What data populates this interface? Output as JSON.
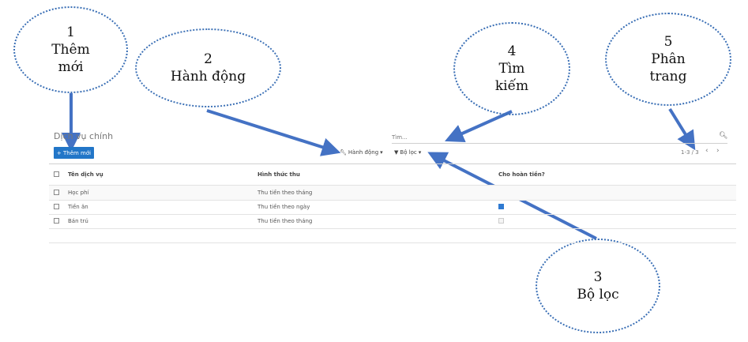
{
  "breadcrumb": {
    "title": "Dịch vụ chính"
  },
  "toolbar": {
    "add_label": "+ Thêm mới",
    "action_label": "Hành động",
    "filter_label": "Bộ lọc",
    "search_placeholder": "Tìm...",
    "pager_text": "1-3 / 3",
    "prev_label": "‹",
    "next_label": "›"
  },
  "table": {
    "columns": [
      "Tên dịch vụ",
      "Hình thức thu",
      "Cho hoàn tiền?"
    ],
    "rows": [
      {
        "name": "Học phí",
        "method": "Thu tiền theo tháng",
        "refund": false,
        "refund_state": "none"
      },
      {
        "name": "Tiền ăn",
        "method": "Thu tiền theo ngày",
        "refund": true,
        "refund_state": "checked"
      },
      {
        "name": "Bán trú",
        "method": "Thu tiền theo tháng",
        "refund": false,
        "refund_state": "disabled"
      }
    ]
  },
  "callouts": [
    {
      "number": "1",
      "text": "Thêm\nmới"
    },
    {
      "number": "2",
      "text": "Hành động"
    },
    {
      "number": "3",
      "text": "Bộ lọc"
    },
    {
      "number": "4",
      "text": "Tìm\nkiếm"
    },
    {
      "number": "5",
      "text": "Phân\ntrang"
    }
  ],
  "colors": {
    "primary": "#2276c8",
    "callout": "#3a6fb5",
    "arrow": "#4472c4"
  }
}
